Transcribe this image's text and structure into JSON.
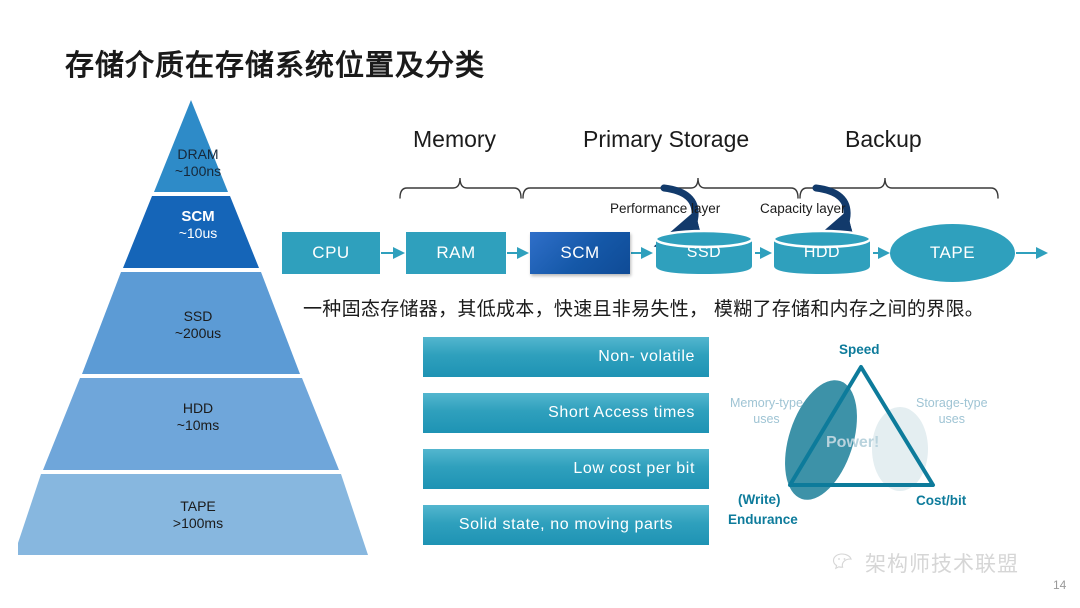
{
  "slide": {
    "title": "存储介质在存储系统位置及分类",
    "page_number": "14",
    "watermark": "架构师技术联盟",
    "caption": "一种固态存储器，其低成本，快速且非易失性， 模糊了存储和内存之间的界限。"
  },
  "pyramid": {
    "levels": [
      {
        "name": "DRAM",
        "value": "~100ns",
        "color": "#2E8BC8"
      },
      {
        "name": "SCM",
        "value": "~10us",
        "color": "#1565B8"
      },
      {
        "name": "SSD",
        "value": "~200us",
        "color": "#5C9BD5"
      },
      {
        "name": "HDD",
        "value": "~10ms",
        "color": "#6FA6DA"
      },
      {
        "name": "TAPE",
        "value": ">100ms",
        "color": "#87B7DF"
      }
    ]
  },
  "headers": {
    "memory": "Memory",
    "primary_storage": "Primary Storage",
    "backup": "Backup"
  },
  "layer_labels": {
    "performance": "Performance layer",
    "capacity": "Capacity layer"
  },
  "flow": {
    "nodes": [
      {
        "label": "CPU",
        "shape": "box"
      },
      {
        "label": "RAM",
        "shape": "box"
      },
      {
        "label": "SCM",
        "shape": "box-gradient"
      },
      {
        "label": "SSD",
        "shape": "cylinder"
      },
      {
        "label": "HDD",
        "shape": "cylinder"
      },
      {
        "label": "TAPE",
        "shape": "ellipse"
      }
    ]
  },
  "features": [
    "Non- volatile",
    "Short  Access  times",
    "Low  cost  per  bit",
    "Solid  state, no  moving  parts"
  ],
  "tradeoff": {
    "speed": "Speed",
    "cost": "Cost/bit",
    "write": "(Write)",
    "endurance": "Endurance",
    "memory_uses_1": "Memory-type",
    "memory_uses_2": "uses",
    "storage_uses_1": "Storage-type",
    "storage_uses_2": "uses",
    "power": "Power!"
  },
  "colors": {
    "teal": "#2FA0BD",
    "scm_blue": "#1558A8",
    "arrow_navy": "#123A6B",
    "tri_accent": "#0d7b9b"
  }
}
